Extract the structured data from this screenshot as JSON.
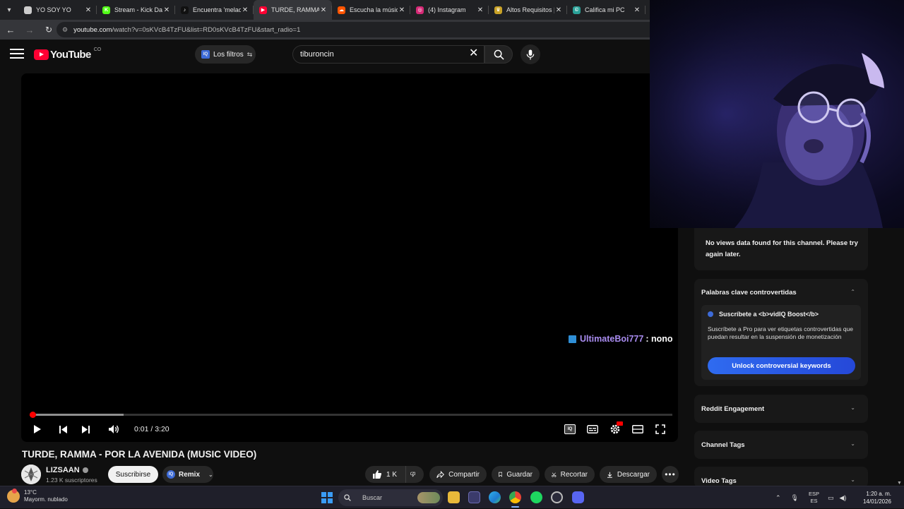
{
  "browser": {
    "tabs": [
      {
        "title": "YO SOY YO",
        "favicon_color": "#cccccc",
        "favicon_glyph": ""
      },
      {
        "title": "Stream - Kick Da",
        "favicon_color": "#53fc18",
        "favicon_glyph": "K"
      },
      {
        "title": "Encuentra 'melao",
        "favicon_color": "#111111",
        "favicon_glyph": "♪"
      },
      {
        "title": "TURDE, RAMMA",
        "favicon_color": "#ff0033",
        "favicon_glyph": "▶"
      },
      {
        "title": "Escucha la músic",
        "favicon_color": "#ff5500",
        "favicon_glyph": "☁"
      },
      {
        "title": "(4) Instagram",
        "favicon_color": "#d62976",
        "favicon_glyph": "◎"
      },
      {
        "title": "Altos Requisitos |",
        "favicon_color": "#c9a227",
        "favicon_glyph": "♛"
      },
      {
        "title": "Califica mi PC",
        "favicon_color": "#2aa198",
        "favicon_glyph": "©"
      }
    ],
    "active_tab_index": 3,
    "url_host": "youtube.com",
    "url_rest": "/watch?v=0sKVcB4TzFU&list=RD0sKVcB4TzFU&start_radio=1"
  },
  "youtube": {
    "logo_text": "YouTube",
    "country_code": "CO",
    "filters_label": "Los filtros",
    "search_value": "tiburoncin",
    "video": {
      "chat_user": "UltimateBoi777",
      "chat_message": ": nono",
      "time_display": "0:01 / 3:20",
      "progress": 0.002,
      "buffered": 0.146
    },
    "title": "TURDE, RAMMA - POR LA AVENIDA (MUSIC VIDEO)",
    "channel_name": "LIZSAAN",
    "subscribers": "1.23 K suscriptores",
    "subscribe_label": "Suscribirse",
    "remix_label": "Remix",
    "like_count": "1 K",
    "share_label": "Compartir",
    "save_label": "Guardar",
    "clip_label": "Recortar",
    "download_label": "Descargar"
  },
  "vidiq": {
    "no_views_text": "No views data found for this channel. Please try again later.",
    "controversial_title": "Palabras clave controvertidas",
    "boost_title": "Suscríbete a <b>vidIQ Boost</b>",
    "boost_desc": "Suscríbete a Pro para ver etiquetas controvertidas que puedan resultar en la suspensión de monetización",
    "unlock_label": "Unlock controversial keywords",
    "sections": [
      "Reddit Engagement",
      "Channel Tags",
      "Video Tags"
    ]
  },
  "taskbar": {
    "temperature": "13°C",
    "weather_desc": "Mayorm. nublado",
    "search_placeholder": "Buscar",
    "lang_top": "ESP",
    "lang_bottom": "ES",
    "time": "1:20 a. m.",
    "date": "14/01/2026"
  }
}
